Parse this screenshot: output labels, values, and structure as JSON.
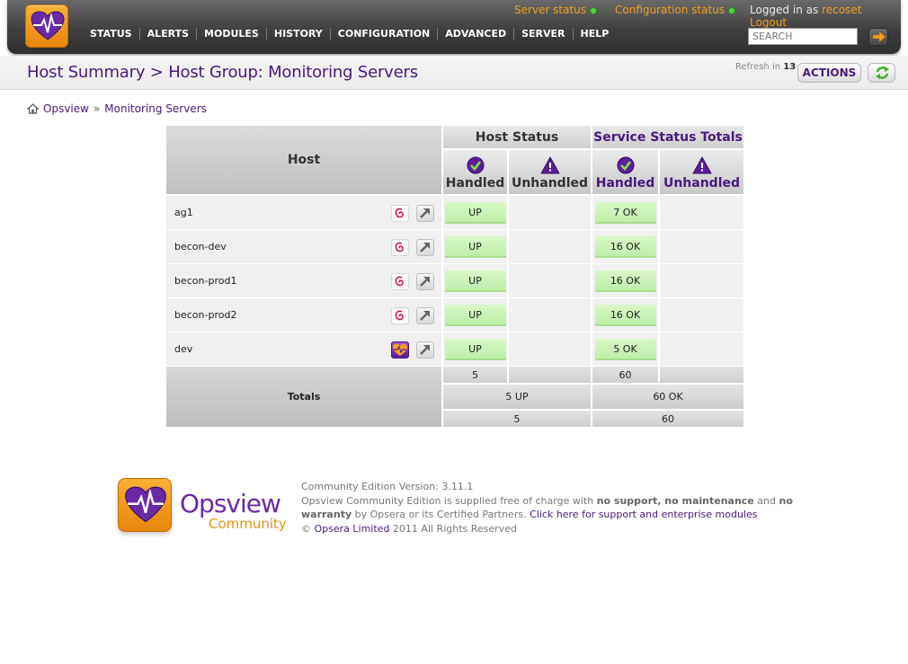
{
  "header": {
    "server_status": "Server status",
    "configuration_status": "Configuration status",
    "logged_in_prefix": "Logged in as",
    "username": "recoset",
    "logout": "Logout",
    "nav": [
      "STATUS",
      "ALERTS",
      "MODULES",
      "HISTORY",
      "CONFIGURATION",
      "ADVANCED",
      "SERVER",
      "HELP"
    ],
    "search_placeholder": "SEARCH"
  },
  "titlebar": {
    "title": "Host Summary > Host Group: Monitoring Servers",
    "refresh_label": "Refresh in",
    "refresh_seconds": "13",
    "actions_label": "ACTIONS"
  },
  "breadcrumb": {
    "root": "Opsview",
    "separator": "»",
    "current": "Monitoring Servers"
  },
  "table": {
    "host_header": "Host",
    "host_status_header": "Host Status",
    "service_status_header": "Service Status Totals",
    "handled": "Handled",
    "unhandled": "Unhandled",
    "rows": [
      {
        "host": "ag1",
        "host_status": "UP",
        "service": "7 OK",
        "os": "debian"
      },
      {
        "host": "becon-dev",
        "host_status": "UP",
        "service": "16 OK",
        "os": "debian"
      },
      {
        "host": "becon-prod1",
        "host_status": "UP",
        "service": "16 OK",
        "os": "debian"
      },
      {
        "host": "becon-prod2",
        "host_status": "UP",
        "service": "16 OK",
        "os": "debian"
      },
      {
        "host": "dev",
        "host_status": "UP",
        "service": "5 OK",
        "os": "opsview"
      }
    ],
    "totals_label": "Totals",
    "host_handled_total": "5",
    "service_handled_total": "60",
    "host_totals": "5 UP",
    "service_totals": "60 OK",
    "host_grand_total": "5",
    "service_grand_total": "60"
  },
  "footer": {
    "brand": "Opsview",
    "brand_sub": "Community",
    "version": "Community Edition Version: 3.11.1",
    "line1_a": "Opsview Community Edition is supplied free of charge with",
    "line1_b": "no support, no maintenance",
    "line1_c": "and",
    "line1_d": "no warranty",
    "line1_e": "by Opsera or its Certified Partners.",
    "support_link": "Click here for support and enterprise modules",
    "copyright_symbol": "©",
    "company": "Opsera Limited",
    "copyright_rest": "2011 All Rights Reserved"
  },
  "colors": {
    "accent_orange": "#f0a020",
    "brand_purple": "#4a1a7a",
    "ok_green": "#bfeeaa",
    "status_dot": "#53d43b"
  }
}
